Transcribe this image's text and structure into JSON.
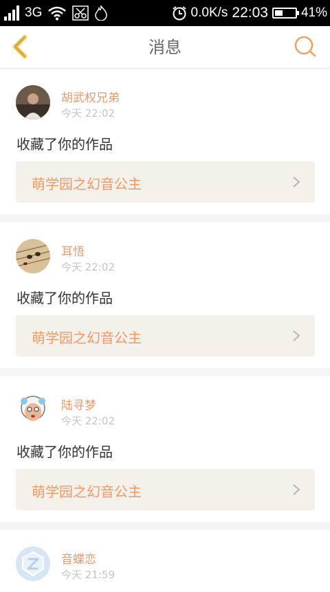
{
  "status_bar": {
    "network": "3G",
    "speed": "0.0K/s",
    "time": "22:03",
    "battery_level": 0.41,
    "battery_text": "41%"
  },
  "header": {
    "title": "消息",
    "back_icon": "chevron-left-icon",
    "search_icon": "search-icon",
    "accent": "#f0a060"
  },
  "messages": [
    {
      "name": "胡武权兄弟",
      "time": "今天 22:02",
      "action": "收藏了你的作品",
      "work_title": "萌学园之幻音公主"
    },
    {
      "name": "耳悟",
      "time": "今天 22:02",
      "action": "收藏了你的作品",
      "work_title": "萌学园之幻音公主"
    },
    {
      "name": "陆寻梦",
      "time": "今天 22:02",
      "action": "收藏了你的作品",
      "work_title": "萌学园之幻音公主"
    },
    {
      "name": "音蝶恋",
      "time": "今天 21:59"
    }
  ]
}
